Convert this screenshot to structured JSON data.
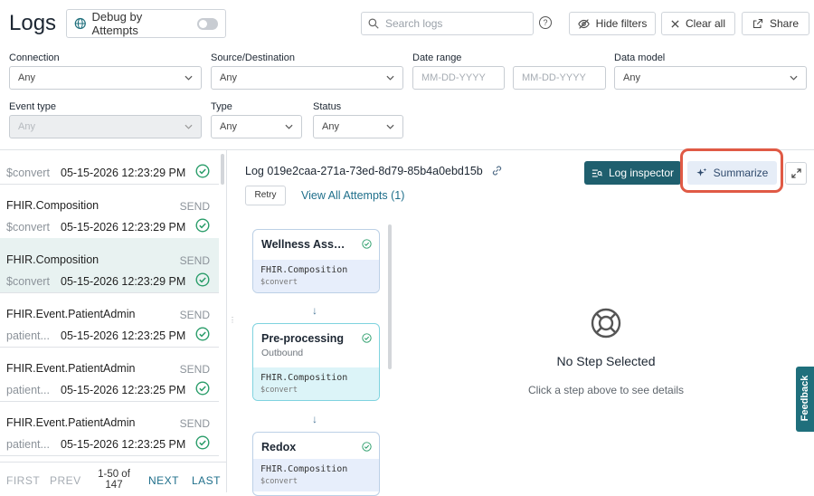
{
  "page_title": "Logs",
  "debug": {
    "label": "Debug by Attempts"
  },
  "search": {
    "placeholder": "Search logs"
  },
  "help": "?",
  "toolbar": {
    "hide_filters": "Hide filters",
    "clear_all": "Clear all",
    "share": "Share"
  },
  "filters": {
    "connection": {
      "label": "Connection",
      "value": "Any"
    },
    "source_destination": {
      "label": "Source/Destination",
      "value": "Any"
    },
    "date_range": {
      "label": "Date range",
      "from_placeholder": "MM-DD-YYYY",
      "to_placeholder": "MM-DD-YYYY"
    },
    "data_model": {
      "label": "Data model",
      "value": "Any"
    },
    "event_type": {
      "label": "Event type",
      "value": "Any"
    },
    "type": {
      "label": "Type",
      "value": "Any"
    },
    "status": {
      "label": "Status",
      "value": "Any"
    }
  },
  "log_list": [
    {
      "name": "",
      "direction": "",
      "sub": "$convert",
      "time": "05-15-2026 12:23:29 PM"
    },
    {
      "name": "FHIR.Composition",
      "direction": "SEND",
      "sub": "$convert",
      "time": "05-15-2026 12:23:29 PM"
    },
    {
      "name": "FHIR.Composition",
      "direction": "SEND",
      "sub": "$convert",
      "time": "05-15-2026 12:23:29 PM"
    },
    {
      "name": "FHIR.Event.PatientAdmin",
      "direction": "SEND",
      "sub": "patient...",
      "time": "05-15-2026 12:23:25 PM"
    },
    {
      "name": "FHIR.Event.PatientAdmin",
      "direction": "SEND",
      "sub": "patient...",
      "time": "05-15-2026 12:23:25 PM"
    },
    {
      "name": "FHIR.Event.PatientAdmin",
      "direction": "SEND",
      "sub": "patient...",
      "time": "05-15-2026 12:23:25 PM"
    }
  ],
  "pager": {
    "first": "FIRST",
    "prev": "PREV",
    "range": "1-50 of",
    "total": "147",
    "next": "NEXT",
    "last": "LAST"
  },
  "detail": {
    "log_id": "Log 019e2caa-271a-73ed-8d79-85b4a0ebd15b",
    "retry": "Retry",
    "view_all": "View All Attempts (1)",
    "log_inspector": "Log inspector",
    "summarize": "Summarize"
  },
  "steps": [
    {
      "title": "Wellness Associ...",
      "subtitle": "",
      "model": "FHIR.Composition",
      "event": "$convert"
    },
    {
      "title": "Pre-processing",
      "subtitle": "Outbound",
      "model": "FHIR.Composition",
      "event": "$convert"
    },
    {
      "title": "Redox",
      "subtitle": "",
      "model": "FHIR.Composition",
      "event": "$convert"
    }
  ],
  "arrow_glyph": "↓",
  "empty_state": {
    "title": "No Step Selected",
    "subtitle": "Click a step above to see details"
  },
  "feedback": "Feedback",
  "colors": {
    "primary": "#1f5f6e",
    "success": "#2a9d6a",
    "highlight": "#e05a45",
    "summarize_bg": "#e6edf7",
    "selected_row": "#e8f2f1"
  }
}
